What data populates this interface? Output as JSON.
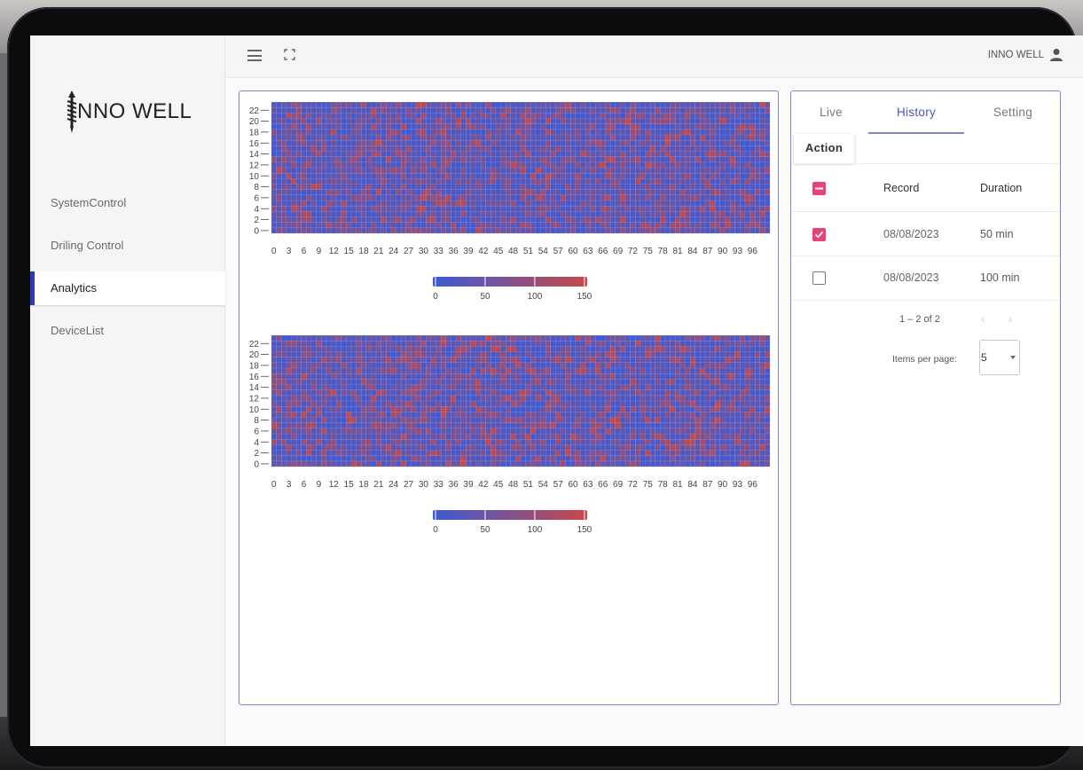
{
  "app": {
    "logo_text": "NNO WELL",
    "user_name": "INNO WELL"
  },
  "sidebar": {
    "items": [
      {
        "label": "SystemControl",
        "active": false
      },
      {
        "label": "Driling Control",
        "active": false
      },
      {
        "label": "Analytics",
        "active": true
      },
      {
        "label": "DeviceList",
        "active": false
      }
    ]
  },
  "panel": {
    "tabs": [
      {
        "label": "Live",
        "active": false
      },
      {
        "label": "History",
        "active": true
      },
      {
        "label": "Setting",
        "active": false
      }
    ],
    "action_label": "Action",
    "columns": [
      "Record",
      "Duration"
    ],
    "rows": [
      {
        "checked": true,
        "record": "08/08/2023",
        "duration": "50 min"
      },
      {
        "checked": false,
        "record": "08/08/2023",
        "duration": "100 min"
      }
    ],
    "pagination": {
      "range_text": "1 – 2 of 2",
      "items_per_page_label": "Items per page:",
      "items_per_page_value": "5"
    }
  },
  "colors": {
    "accent": "#2c3bb5",
    "panel_border": "#7d86d6",
    "checkbox_checked": "#e84377",
    "heatmap_low": "#3b5bd6",
    "heatmap_high": "#c84848"
  },
  "chart_data": [
    {
      "type": "heatmap",
      "x_ticks": [
        0,
        3,
        6,
        9,
        12,
        15,
        18,
        21,
        24,
        27,
        30,
        33,
        36,
        39,
        42,
        45,
        48,
        51,
        54,
        57,
        60,
        63,
        66,
        69,
        72,
        75,
        78,
        81,
        84,
        87,
        90,
        93,
        96
      ],
      "y_ticks": [
        0,
        2,
        4,
        6,
        8,
        10,
        12,
        14,
        16,
        18,
        20,
        22
      ],
      "x_range": [
        0,
        99
      ],
      "y_range": [
        0,
        23
      ],
      "value_range": [
        0,
        150
      ],
      "colorbar_ticks": [
        0,
        50,
        100,
        150
      ],
      "colormap": [
        "#3b5bd6",
        "#c84848"
      ]
    },
    {
      "type": "heatmap",
      "x_ticks": [
        0,
        3,
        6,
        9,
        12,
        15,
        18,
        21,
        24,
        27,
        30,
        33,
        36,
        39,
        42,
        45,
        48,
        51,
        54,
        57,
        60,
        63,
        66,
        69,
        72,
        75,
        78,
        81,
        84,
        87,
        90,
        93,
        96
      ],
      "y_ticks": [
        0,
        2,
        4,
        6,
        8,
        10,
        12,
        14,
        16,
        18,
        20,
        22
      ],
      "x_range": [
        0,
        99
      ],
      "y_range": [
        0,
        23
      ],
      "value_range": [
        0,
        150
      ],
      "colorbar_ticks": [
        0,
        50,
        100,
        150
      ],
      "colormap": [
        "#3b5bd6",
        "#c84848"
      ]
    }
  ]
}
